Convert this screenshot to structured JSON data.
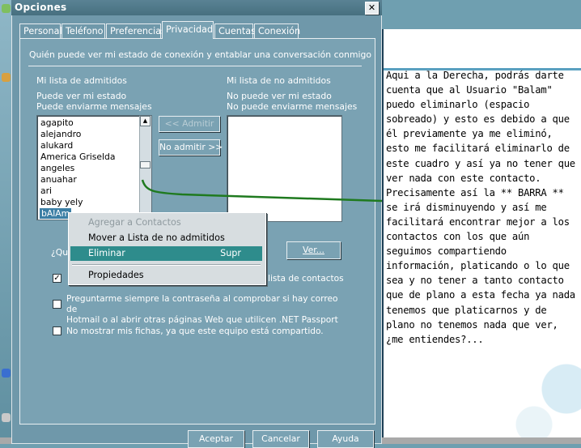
{
  "dialog": {
    "title": "Opciones",
    "close_symbol": "✕",
    "tabs": [
      {
        "label": "Personal"
      },
      {
        "label": "Teléfono"
      },
      {
        "label": "Preferencias"
      },
      {
        "label": "Privacidad"
      },
      {
        "label": "Cuentas"
      },
      {
        "label": "Conexión"
      }
    ],
    "section_heading": "Quién puede ver mi estado de conexión y entablar una conversación conmigo",
    "allow_list": {
      "title": "Mi lista de admitidos",
      "line1": "Puede ver mi estado",
      "line2": "Puede enviarme mensajes",
      "items": [
        "agapito",
        "alejandro",
        "alukard",
        "America Griselda",
        "angeles",
        "anuahar",
        "ari",
        "baby yely",
        "bAlAm"
      ],
      "selected": "bAlAm"
    },
    "block_list": {
      "title": "Mi lista de no admitidos",
      "line1": "No puede ver mi estado",
      "line2": "No puede enviarme mensajes"
    },
    "buttons": {
      "admit": "<< Admitir",
      "no_admit": "No admitir >>",
      "view": "Ver...",
      "accept": "Aceptar",
      "cancel": "Cancelar",
      "help": "Ayuda"
    },
    "partial_question": "¿Qu",
    "partial_checkbox_text": "lista de contactos",
    "option_password": {
      "line1": "Preguntarme siempre la contraseña al comprobar si hay correo de",
      "line2": "Hotmail o al abrir otras páginas Web que utilicen .NET Passport",
      "checked": false
    },
    "option_profiles": {
      "label": "No mostrar mis fichas, ya que este equipo está compartido.",
      "checked": false
    },
    "checkmark": "✓"
  },
  "context_menu": {
    "items": [
      {
        "label": "Agregar a Contactos",
        "enabled": false
      },
      {
        "label": "Mover a Lista de no admitidos",
        "enabled": true
      },
      {
        "label": "Eliminar",
        "shortcut": "Supr",
        "enabled": true,
        "highlighted": true
      },
      {
        "label": "Propiedades",
        "enabled": true
      }
    ]
  },
  "note": {
    "text": "Aqui a la Derecha, podrás darte cuenta que al Usuario \"Balam\" puedo eliminarlo (espacio sobreado) y esto es debido a que él previamente ya me eliminó, esto me facilitará eliminarlo de este cuadro y así ya no tener que ver nada con este contacto. Precisamente así la ** BARRA ** se irá disminuyendo y así me facilitará encontrar mejor a los contactos con los que aún seguimos compartiendo información, platicando o lo que sea y no tener a tanto contacto que de plano a esta fecha ya nada tenemos que platicarnos y de plano no tenemos nada que ver, ¿me entiendes?..."
  },
  "colors": {
    "annotation_line": "#1f7a1f",
    "menu_highlight": "#2e8c8c",
    "dialog_bg": "#7aa2b3"
  }
}
